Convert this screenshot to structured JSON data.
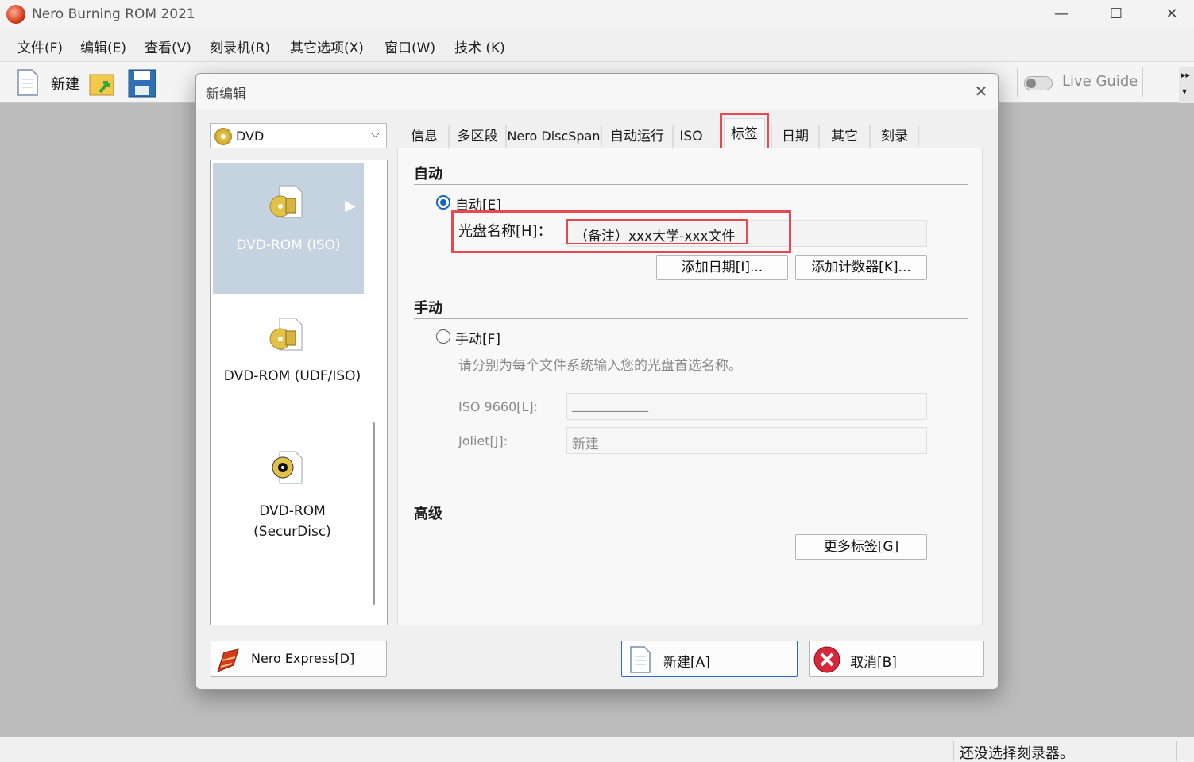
{
  "app": {
    "title": "Nero Burning ROM 2021"
  },
  "window_controls": {
    "minimize": "—",
    "maximize": "☐",
    "close": "✕"
  },
  "menu": [
    "文件(F)",
    "编辑(E)",
    "查看(V)",
    "刻录机(R)",
    "其它选项(X)",
    "窗口(W)",
    "技术 (K)"
  ],
  "toolbar": {
    "new_label": "新建",
    "live_guide_label": "Live Guide"
  },
  "status_bar": {
    "message": "还没选择刻录器。"
  },
  "dialog": {
    "title": "新编辑",
    "close": "✕",
    "disc_type": "DVD",
    "compilation_types": [
      {
        "label": "DVD-ROM (ISO)",
        "selected": true
      },
      {
        "label": "DVD-ROM (UDF/ISO)",
        "selected": false
      },
      {
        "label": "DVD-ROM\n(SecurDisc)",
        "selected": false
      }
    ],
    "tabs": [
      "信息",
      "多区段",
      "Nero DiscSpan",
      "自动运行",
      "ISO",
      "标签",
      "日期",
      "其它",
      "刻录"
    ],
    "active_tab": "标签",
    "auto_section": {
      "heading": "自动",
      "radio_label": "自动[E]",
      "disc_name_label": "光盘名称[H]：",
      "disc_name_value": "（备注）xxx大学-xxx文件",
      "add_date_button": "添加日期[I]...",
      "add_counter_button": "添加计数器[K]..."
    },
    "manual_section": {
      "heading": "手动",
      "radio_label": "手动[F]",
      "hint": "请分别为每个文件系统输入您的光盘首选名称。",
      "iso_label": "ISO 9660[L]:",
      "iso_value": "____________",
      "joliet_label": "Joliet[J]:",
      "joliet_value": "新建"
    },
    "advanced_section": {
      "heading": "高级",
      "more_labels_button": "更多标签[G]"
    },
    "nero_express_button": "Nero Express[D]",
    "new_button": "新建[A]",
    "cancel_button": "取消[B]"
  },
  "colors": {
    "highlight_red": "#e84850",
    "selected_item_bg": "#c5d3e0",
    "radio_blue": "#1565c0"
  }
}
